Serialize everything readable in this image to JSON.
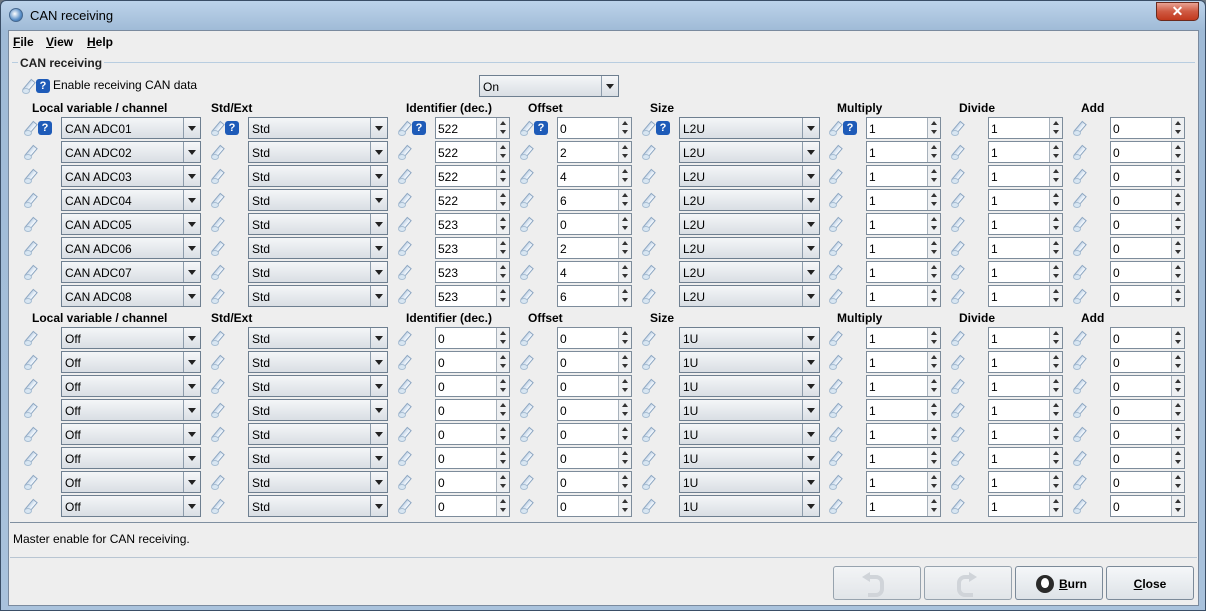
{
  "window": {
    "title": "CAN receiving",
    "close_glyph": "✕"
  },
  "menu": [
    {
      "label": "File",
      "accel": "F",
      "rest": "ile"
    },
    {
      "label": "View",
      "accel": "V",
      "rest": "iew"
    },
    {
      "label": "Help",
      "accel": "H",
      "rest": "elp"
    }
  ],
  "group_title": "CAN receiving",
  "enable": {
    "label": "Enable receiving CAN data",
    "value": "On"
  },
  "headers": {
    "local": "Local variable / channel",
    "stdext": "Std/Ext",
    "identifier": "Identifier (dec.)",
    "offset": "Offset",
    "size": "Size",
    "multiply": "Multiply",
    "divide": "Divide",
    "add": "Add"
  },
  "help_glyph": "?",
  "block1": [
    {
      "local": "CAN ADC01",
      "stdext": "Std",
      "identifier": "522",
      "offset": "0",
      "size": "L2U",
      "multiply": "1",
      "divide": "1",
      "add": "0"
    },
    {
      "local": "CAN ADC02",
      "stdext": "Std",
      "identifier": "522",
      "offset": "2",
      "size": "L2U",
      "multiply": "1",
      "divide": "1",
      "add": "0"
    },
    {
      "local": "CAN ADC03",
      "stdext": "Std",
      "identifier": "522",
      "offset": "4",
      "size": "L2U",
      "multiply": "1",
      "divide": "1",
      "add": "0"
    },
    {
      "local": "CAN ADC04",
      "stdext": "Std",
      "identifier": "522",
      "offset": "6",
      "size": "L2U",
      "multiply": "1",
      "divide": "1",
      "add": "0"
    },
    {
      "local": "CAN ADC05",
      "stdext": "Std",
      "identifier": "523",
      "offset": "0",
      "size": "L2U",
      "multiply": "1",
      "divide": "1",
      "add": "0"
    },
    {
      "local": "CAN ADC06",
      "stdext": "Std",
      "identifier": "523",
      "offset": "2",
      "size": "L2U",
      "multiply": "1",
      "divide": "1",
      "add": "0"
    },
    {
      "local": "CAN ADC07",
      "stdext": "Std",
      "identifier": "523",
      "offset": "4",
      "size": "L2U",
      "multiply": "1",
      "divide": "1",
      "add": "0"
    },
    {
      "local": "CAN ADC08",
      "stdext": "Std",
      "identifier": "523",
      "offset": "6",
      "size": "L2U",
      "multiply": "1",
      "divide": "1",
      "add": "0"
    }
  ],
  "block2": [
    {
      "local": "Off",
      "stdext": "Std",
      "identifier": "0",
      "offset": "0",
      "size": "1U",
      "multiply": "1",
      "divide": "1",
      "add": "0"
    },
    {
      "local": "Off",
      "stdext": "Std",
      "identifier": "0",
      "offset": "0",
      "size": "1U",
      "multiply": "1",
      "divide": "1",
      "add": "0"
    },
    {
      "local": "Off",
      "stdext": "Std",
      "identifier": "0",
      "offset": "0",
      "size": "1U",
      "multiply": "1",
      "divide": "1",
      "add": "0"
    },
    {
      "local": "Off",
      "stdext": "Std",
      "identifier": "0",
      "offset": "0",
      "size": "1U",
      "multiply": "1",
      "divide": "1",
      "add": "0"
    },
    {
      "local": "Off",
      "stdext": "Std",
      "identifier": "0",
      "offset": "0",
      "size": "1U",
      "multiply": "1",
      "divide": "1",
      "add": "0"
    },
    {
      "local": "Off",
      "stdext": "Std",
      "identifier": "0",
      "offset": "0",
      "size": "1U",
      "multiply": "1",
      "divide": "1",
      "add": "0"
    },
    {
      "local": "Off",
      "stdext": "Std",
      "identifier": "0",
      "offset": "0",
      "size": "1U",
      "multiply": "1",
      "divide": "1",
      "add": "0"
    },
    {
      "local": "Off",
      "stdext": "Std",
      "identifier": "0",
      "offset": "0",
      "size": "1U",
      "multiply": "1",
      "divide": "1",
      "add": "0"
    }
  ],
  "status_text": "Master enable for CAN receiving.",
  "buttons": {
    "undo_icon": "undo-icon",
    "redo_icon": "redo-icon",
    "burn": "Burn",
    "close": "Close"
  }
}
